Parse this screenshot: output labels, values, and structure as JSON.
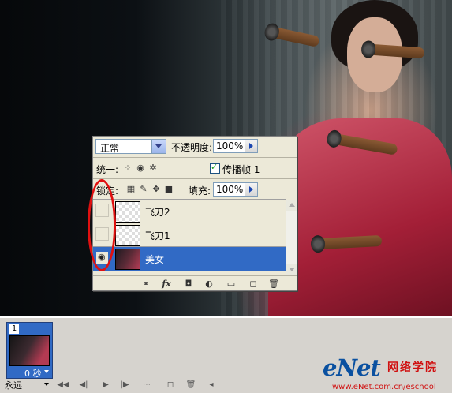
{
  "layers_panel": {
    "blend_mode": "正常",
    "opacity_label": "不透明度:",
    "opacity_value": "100%",
    "unify_label": "统一:",
    "propagate_label": "传播帧 1",
    "propagate_checked": true,
    "lock_label": "锁定:",
    "fill_label": "填充:",
    "fill_value": "100%",
    "layers": [
      {
        "name": "飞刀2",
        "visible": false,
        "selected": false
      },
      {
        "name": "飞刀1",
        "visible": false,
        "selected": false
      },
      {
        "name": "美女",
        "visible": true,
        "selected": true
      }
    ],
    "bottom_icons": [
      "link-icon",
      "fx-icon",
      "mask-icon",
      "adjustment-icon",
      "folder-icon",
      "new-layer-icon",
      "trash-icon"
    ]
  },
  "animation_panel": {
    "frame_number": "1",
    "frame_delay": "0 秒",
    "loop_option": "永远",
    "controls": [
      "first-frame-icon",
      "prev-frame-icon",
      "play-icon",
      "next-frame-icon",
      "tween-icon",
      "duplicate-frame-icon",
      "delete-frame-icon"
    ]
  },
  "watermark": {
    "logo": "eNet",
    "cn_text": "网络学院",
    "url": "www.eNet.com.cn/eschool"
  },
  "colors": {
    "selection": "#316ac5",
    "annotation": "#e01010",
    "panel_bg": "#ece9d8"
  }
}
